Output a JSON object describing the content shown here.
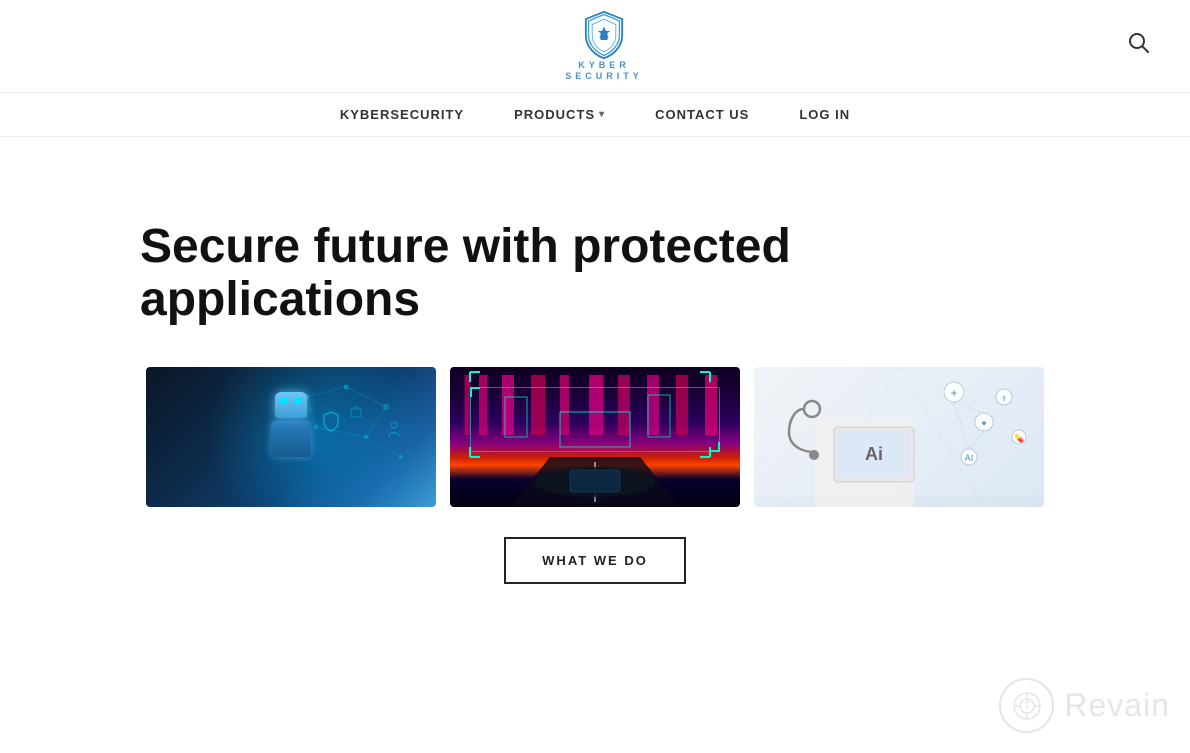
{
  "brand": {
    "name": "KYBER",
    "sub": "SECURITY",
    "logo_alt": "Kyber Security Shield Logo"
  },
  "nav": {
    "items": [
      {
        "id": "kybersecurity",
        "label": "KYBERSECURITY",
        "has_dropdown": false
      },
      {
        "id": "products",
        "label": "PRODUCTS",
        "has_dropdown": true
      },
      {
        "id": "contact",
        "label": "CONTACT US",
        "has_dropdown": false
      },
      {
        "id": "login",
        "label": "LOG IN",
        "has_dropdown": false
      }
    ]
  },
  "hero": {
    "title": "Secure future with protected applications"
  },
  "images": [
    {
      "id": "robot",
      "alt": "AI Robot cybersecurity"
    },
    {
      "id": "car",
      "alt": "Autonomous vehicle AI"
    },
    {
      "id": "medical",
      "alt": "Medical AI technology"
    }
  ],
  "cta": {
    "label": "WHAT WE DO"
  },
  "watermark": {
    "brand": "Revain"
  },
  "search": {
    "icon_label": "🔍"
  }
}
